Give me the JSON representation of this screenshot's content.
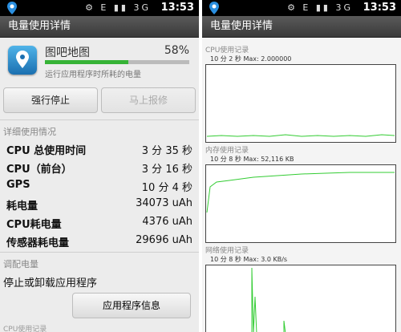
{
  "status": {
    "time": "13:53",
    "icons": "⚙ E ▮▮ 3G"
  },
  "left": {
    "title": "电量使用详情",
    "app": {
      "name": "图吧地图",
      "percent": "58%",
      "usage_fraction": 0.58,
      "desc": "运行应用程序时所耗的电量"
    },
    "buttons": {
      "force_stop": "强行停止",
      "report": "马上报修"
    },
    "details_header": "详细使用情况",
    "rows": [
      {
        "k": "CPU 总使用时间",
        "v": "3 分 35 秒"
      },
      {
        "k": "CPU（前台）",
        "v": "3 分 16 秒"
      },
      {
        "k": "GPS",
        "v": "10 分 4 秒"
      },
      {
        "k": "耗电量",
        "v": "34073 uAh"
      },
      {
        "k": "CPU耗电量",
        "v": "4376 uAh"
      },
      {
        "k": "传感器耗电量",
        "v": "29696 uAh"
      }
    ],
    "adjust_header": "调配电量",
    "stop_text": "停止或卸载应用程序",
    "info_button": "应用程序信息",
    "cpu_footer": "CPU使用记录"
  },
  "right": {
    "title": "电量使用详情",
    "graphs": [
      {
        "section": "CPU使用记录",
        "caption": "10 分 2 秒 Max: 2.000000"
      },
      {
        "section": "内存使用记录",
        "caption": "10 分 8 秒 Max: 52,116 KB"
      },
      {
        "section": "网络使用记录",
        "caption": "10 分 8 秒 Max: 3.0 KB/s"
      }
    ]
  },
  "colors": {
    "accent_green": "#36b336",
    "graph_line": "#33cc33",
    "bar_bg": "#bbbbbb"
  }
}
